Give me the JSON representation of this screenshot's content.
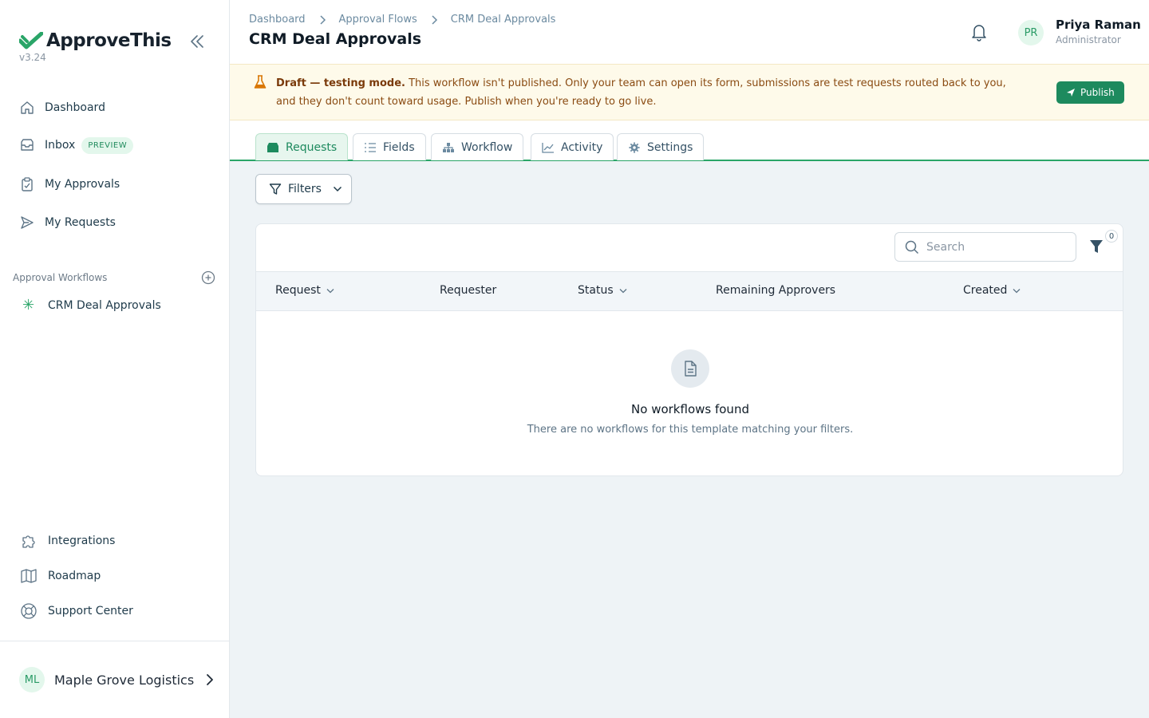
{
  "app": {
    "name": "ApproveThis",
    "version": "v3.24",
    "brand_color": "#2aa568"
  },
  "sidebar": {
    "nav": [
      {
        "label": "Dashboard",
        "icon": "home-icon"
      },
      {
        "label": "Inbox",
        "icon": "inbox-icon",
        "badge": "PREVIEW"
      },
      {
        "label": "My Approvals",
        "icon": "clipboard-check-icon"
      },
      {
        "label": "My Requests",
        "icon": "send-icon"
      }
    ],
    "workflows_section": {
      "label": "Approval Workflows",
      "items": [
        {
          "label": "CRM Deal Approvals",
          "icon": "asterisk-icon"
        }
      ]
    },
    "bottom_nav": [
      {
        "label": "Integrations",
        "icon": "puzzle-icon"
      },
      {
        "label": "Roadmap",
        "icon": "map-icon"
      },
      {
        "label": "Support Center",
        "icon": "lifebuoy-icon"
      }
    ],
    "org": {
      "initials": "ML",
      "name": "Maple Grove Logistics"
    }
  },
  "header": {
    "breadcrumbs": [
      "Dashboard",
      "Approval Flows",
      "CRM Deal Approvals"
    ],
    "title": "CRM Deal Approvals",
    "user": {
      "initials": "PR",
      "name": "Priya Raman",
      "role": "Administrator"
    }
  },
  "banner": {
    "strong": "Draft — testing mode.",
    "text": " This workflow isn't published. Only your team can open its form, submissions are test requests routed back to you, and they don't count toward usage. Publish when you're ready to go live.",
    "publish_label": "Publish",
    "color": "#fefaea"
  },
  "tabs": [
    {
      "label": "Requests",
      "icon": "inbox-tray-icon",
      "active": true
    },
    {
      "label": "Fields",
      "icon": "list-icon",
      "active": false
    },
    {
      "label": "Workflow",
      "icon": "hierarchy-icon",
      "active": false
    },
    {
      "label": "Activity",
      "icon": "chart-line-icon",
      "active": false
    },
    {
      "label": "Settings",
      "icon": "gear-icon",
      "active": false
    }
  ],
  "filters": {
    "label": "Filters",
    "count": "0"
  },
  "table": {
    "search_placeholder": "Search",
    "columns": [
      "Request",
      "Requester",
      "Status",
      "Remaining Approvers",
      "Created"
    ],
    "empty": {
      "title": "No workflows found",
      "subtitle": "There are no workflows for this template matching your filters."
    }
  }
}
